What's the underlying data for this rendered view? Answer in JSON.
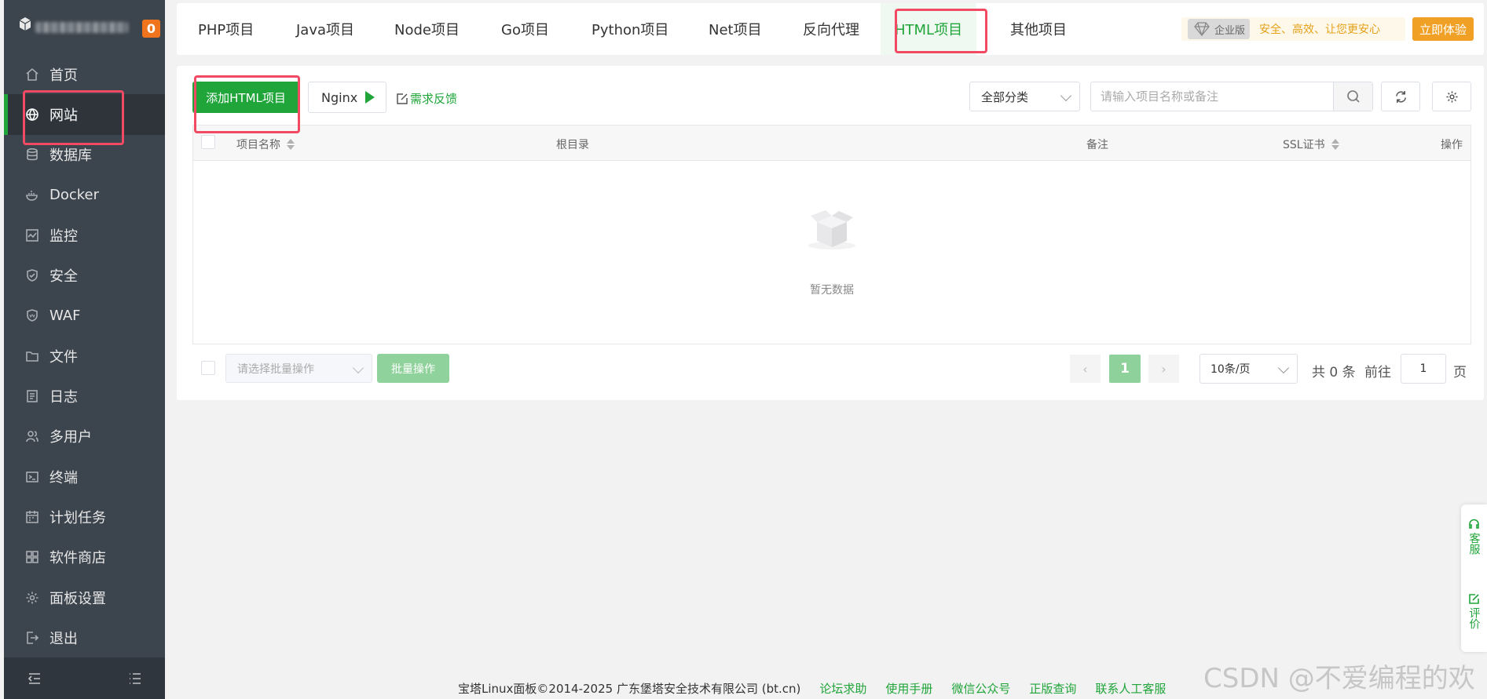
{
  "sidebar": {
    "badge": "0",
    "items": [
      {
        "label": "首页",
        "icon": "home-icon"
      },
      {
        "label": "网站",
        "icon": "globe-icon"
      },
      {
        "label": "数据库",
        "icon": "database-icon"
      },
      {
        "label": "Docker",
        "icon": "docker-icon"
      },
      {
        "label": "监控",
        "icon": "monitor-icon"
      },
      {
        "label": "安全",
        "icon": "shield-icon"
      },
      {
        "label": "WAF",
        "icon": "waf-shield-icon"
      },
      {
        "label": "文件",
        "icon": "folder-icon"
      },
      {
        "label": "日志",
        "icon": "log-icon"
      },
      {
        "label": "多用户",
        "icon": "users-icon"
      },
      {
        "label": "终端",
        "icon": "terminal-icon"
      },
      {
        "label": "计划任务",
        "icon": "calendar-icon"
      },
      {
        "label": "软件商店",
        "icon": "apps-icon"
      },
      {
        "label": "面板设置",
        "icon": "gear-icon"
      },
      {
        "label": "退出",
        "icon": "logout-icon"
      }
    ]
  },
  "tabs": [
    "PHP项目",
    "Java项目",
    "Node项目",
    "Go项目",
    "Python项目",
    "Net项目",
    "反向代理",
    "HTML项目",
    "其他项目"
  ],
  "enterprise": {
    "tag": "企业版",
    "slogan": "安全、高效、让您更安心",
    "button": "立即体验"
  },
  "toolbar": {
    "add_label": "添加HTML项目",
    "nginx_label": "Nginx",
    "feedback_label": "需求反馈",
    "category_value": "全部分类",
    "search_placeholder": "请输入项目名称或备注"
  },
  "table": {
    "columns": [
      "项目名称",
      "根目录",
      "备注",
      "SSL证书",
      "操作"
    ],
    "empty_text": "暂无数据"
  },
  "footer_bar": {
    "batch_placeholder": "请选择批量操作",
    "batch_button": "批量操作",
    "current_page": "1",
    "page_size": "10条/页",
    "total": "共 0 条",
    "goto": "前往",
    "goto_value": "1",
    "page_suffix": "页"
  },
  "float": {
    "service": "客服",
    "review": "评价"
  },
  "footer": {
    "copyright": "宝塔Linux面板©2014-2025 广东堡塔安全技术有限公司 (bt.cn)",
    "links": [
      "论坛求助",
      "使用手册",
      "微信公众号",
      "正版查询",
      "联系人工客服"
    ]
  },
  "watermark": "CSDN @不爱编程的欢",
  "colors": {
    "accent": "#20a53a",
    "sidebar": "#3c444d",
    "highlight": "#f24a63",
    "orange": "#f0a024"
  }
}
